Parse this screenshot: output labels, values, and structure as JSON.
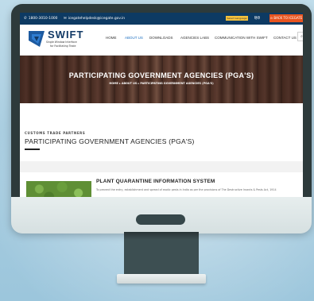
{
  "topbar": {
    "phone": "1800-3010-1000",
    "email": "icegatehelpdesk@icegate.gov.in",
    "google_badge": "Select Language",
    "hindi": "हिंदी",
    "back_label": "BACK TO ICEGATE"
  },
  "brand": {
    "title": "SWIFT",
    "subtitle1": "Single Window Interface",
    "subtitle2": "for Facilitating Trade"
  },
  "nav": {
    "items": [
      "HOME",
      "ABOUT US",
      "DOWNLOADS",
      "AGENCIES LABS",
      "COMMUNICATION WITH SWIFT",
      "CONTACT US"
    ],
    "active_index": 1,
    "search_icon": "⌕"
  },
  "hero": {
    "title": "PARTICIPATING GOVERNMENT AGENCIES (PGA'S)",
    "breadcrumb": "HOME  ▸  ABOUT US  ▸  PARTICIPATING GOVERNMENT AGENCIES (PGA'S)"
  },
  "section": {
    "label": "CUSTOMS TRADE PARTNERS",
    "title": "PARTICIPATING GOVERNMENT AGENCIES (PGA'S)"
  },
  "card": {
    "title": "PLANT QUARANTINE INFORMATION SYSTEM",
    "text": "To prevent the entry, establishment and spread of exotic pests in India as per the provisions of The Destructive Insects & Pests Act, 1914"
  },
  "colors": {
    "topbar": "#0d3a63",
    "accent_orange": "#e8541f",
    "nav_active": "#1d6fc0",
    "monitor": "#2d3a3b"
  }
}
